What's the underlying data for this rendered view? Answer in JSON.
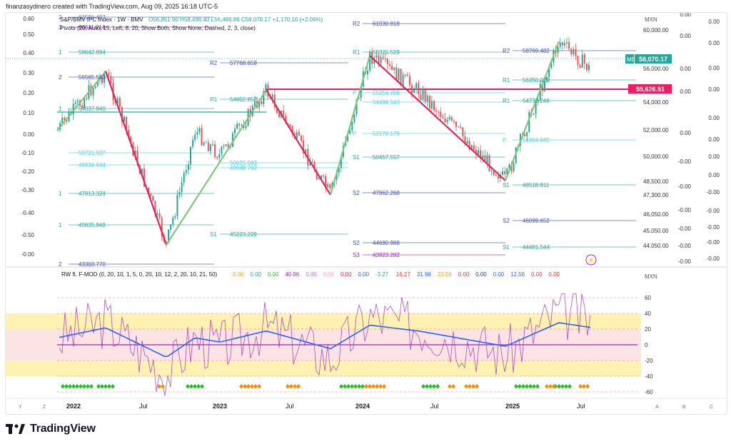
{
  "header": {
    "publisher_line": "finanzasydinero created with TradingView.com, Aug 09, 2025 16:18 UTC-5"
  },
  "legend": {
    "symbol_line": "S&P/BMV IPC Index · 1W · BMV",
    "ohlc": "O56,851.90 H58,496.40 L56,486.86 C58,070.17 +1,170.10 (+2.06%)",
    "pivots_line": "Pivots (20, Auto, 15, Left, 8, 20, Show Both, Show None, Dashed, 2, 3, close)",
    "osc_title": "RW ft. F-MOD (0, 20, 10, 1, 5, 0, 20, 10, 12, 2, 20, 10, 21, 50)",
    "osc_values": [
      {
        "v": "0.00",
        "c": "#f0a000"
      },
      {
        "v": "0.00",
        "c": "#26a69a"
      },
      {
        "v": "0.00",
        "c": "#3bb53b"
      },
      {
        "v": "40.96",
        "c": "#9c27b0"
      },
      {
        "v": "0.00",
        "c": "#b46fd8"
      },
      {
        "v": "0.00",
        "c": "#ff9ad0"
      },
      {
        "v": "0.00",
        "c": "#e91e63"
      },
      {
        "v": "0.00",
        "c": "#2962ff"
      },
      {
        "v": "-3.27",
        "c": "#26a69a"
      },
      {
        "v": "16.27",
        "c": "#e53935"
      },
      {
        "v": "31.98",
        "c": "#2962ff"
      },
      {
        "v": "23.56",
        "c": "#f0a000"
      },
      {
        "v": "0.00",
        "c": "#e53935"
      },
      {
        "v": "0.00",
        "c": "#1e3a8a"
      },
      {
        "v": "0.00",
        "c": "#2962ff"
      },
      {
        "v": "12.56",
        "c": "#2962ff"
      },
      {
        "v": "0.00",
        "c": "#e53935"
      },
      {
        "v": "0.00",
        "c": "#e53935"
      }
    ]
  },
  "left_scale": [
    "0.60",
    "0.50",
    "0.40",
    "0.30",
    "0.20",
    "0.10",
    "0.00",
    "-0.10",
    "-0.20",
    "-0.30",
    "-0.40",
    "-0.50",
    "-0.00"
  ],
  "left_scale_extra": [
    "0.00",
    "0.00"
  ],
  "price_axis": {
    "currency": "MXN",
    "labels": [
      "60,000.00",
      "56,000.00",
      "54,000.00",
      "52,000.00",
      "50,000.00",
      "48,500.00",
      "47,300.00",
      "46,050.00",
      "45,050.00",
      "44,050.00"
    ],
    "current_tag": "ME",
    "current_price": "58,070.17",
    "line_price": "55,626.51",
    "far_right": [
      "0.00",
      "0.00",
      "0.00",
      "0.00",
      "0.00",
      "0.00",
      "0.00",
      "0.00",
      "-0.00",
      "-0.00",
      "-0.00",
      "-0.00",
      "-0.00",
      "-0.00",
      "-0.00"
    ],
    "mid_col": [
      "0.00",
      "0.00",
      "0.00",
      "0.00",
      "0.00",
      "-0.00",
      "-0.00",
      "-0.00",
      "-0.00",
      "-0.00",
      "-0.00",
      "-0.00"
    ]
  },
  "osc_axis": {
    "currency": "MXN",
    "labels": [
      "60",
      "40",
      "20",
      "0",
      "-20",
      "-40",
      "-60"
    ]
  },
  "time_axis": {
    "labels": [
      "2022",
      "Jul",
      "2023",
      "Jul",
      "2024",
      "Jul",
      "2025",
      "Jul"
    ],
    "corner_left": [
      "Y",
      "Z"
    ],
    "corner_right": [
      "A",
      "B",
      "C"
    ]
  },
  "pivot_levels": [
    {
      "tag": "2",
      "val": "61501.497"
    },
    {
      "tag": "3",
      "val": "60611.214"
    },
    {
      "tag": "1",
      "val": "58642.894"
    },
    {
      "tag": "2",
      "val": "56565.543"
    },
    {
      "tag": "1",
      "val": "54037.840"
    },
    {
      "tag": "",
      "val": "50721.927"
    },
    {
      "tag": "",
      "val": "49934.644"
    },
    {
      "tag": "1",
      "val": "47913.324"
    },
    {
      "tag": "1",
      "val": "45835.949"
    },
    {
      "tag": "2",
      "val": "43303.770"
    },
    {
      "tag": "R2",
      "val": "57768.659"
    },
    {
      "tag": "R1",
      "val": "54802.857"
    },
    {
      "tag": "",
      "val": "50015.583"
    },
    {
      "tag": "",
      "val": "49648.742"
    },
    {
      "tag": "S1",
      "val": "45223.229"
    },
    {
      "tag": "R2",
      "val": "61030.818"
    },
    {
      "tag": "R1",
      "val": "58325.529"
    },
    {
      "tag": "P",
      "val": "55254.789"
    },
    {
      "tag": "",
      "val": "54496.543"
    },
    {
      "tag": "P",
      "val": "52170.179"
    },
    {
      "tag": "S1",
      "val": "50457.557"
    },
    {
      "tag": "S2",
      "val": "47962.268"
    },
    {
      "tag": "S2",
      "val": "44680.988"
    },
    {
      "tag": "S3",
      "val": "43923.282"
    },
    {
      "tag": "R2",
      "val": "58769.482"
    },
    {
      "tag": "R1",
      "val": "56350.223"
    },
    {
      "tag": "R1",
      "val": "54732.246"
    },
    {
      "tag": "P",
      "val": "51804.845"
    },
    {
      "tag": "S1",
      "val": "48518.811"
    },
    {
      "tag": "S2",
      "val": "46099.652"
    },
    {
      "tag": "S1",
      "val": "44481.544"
    }
  ],
  "footer": {
    "brand": "TradingView"
  },
  "colors": {
    "bull": "#26a69a",
    "bear": "#ef5350",
    "zig_up": "#7ec87e",
    "zig_down": "#e0245e",
    "osc_blue": "#2962ff",
    "osc_purple": "#9c27b0",
    "band": "#fff2b3"
  }
}
